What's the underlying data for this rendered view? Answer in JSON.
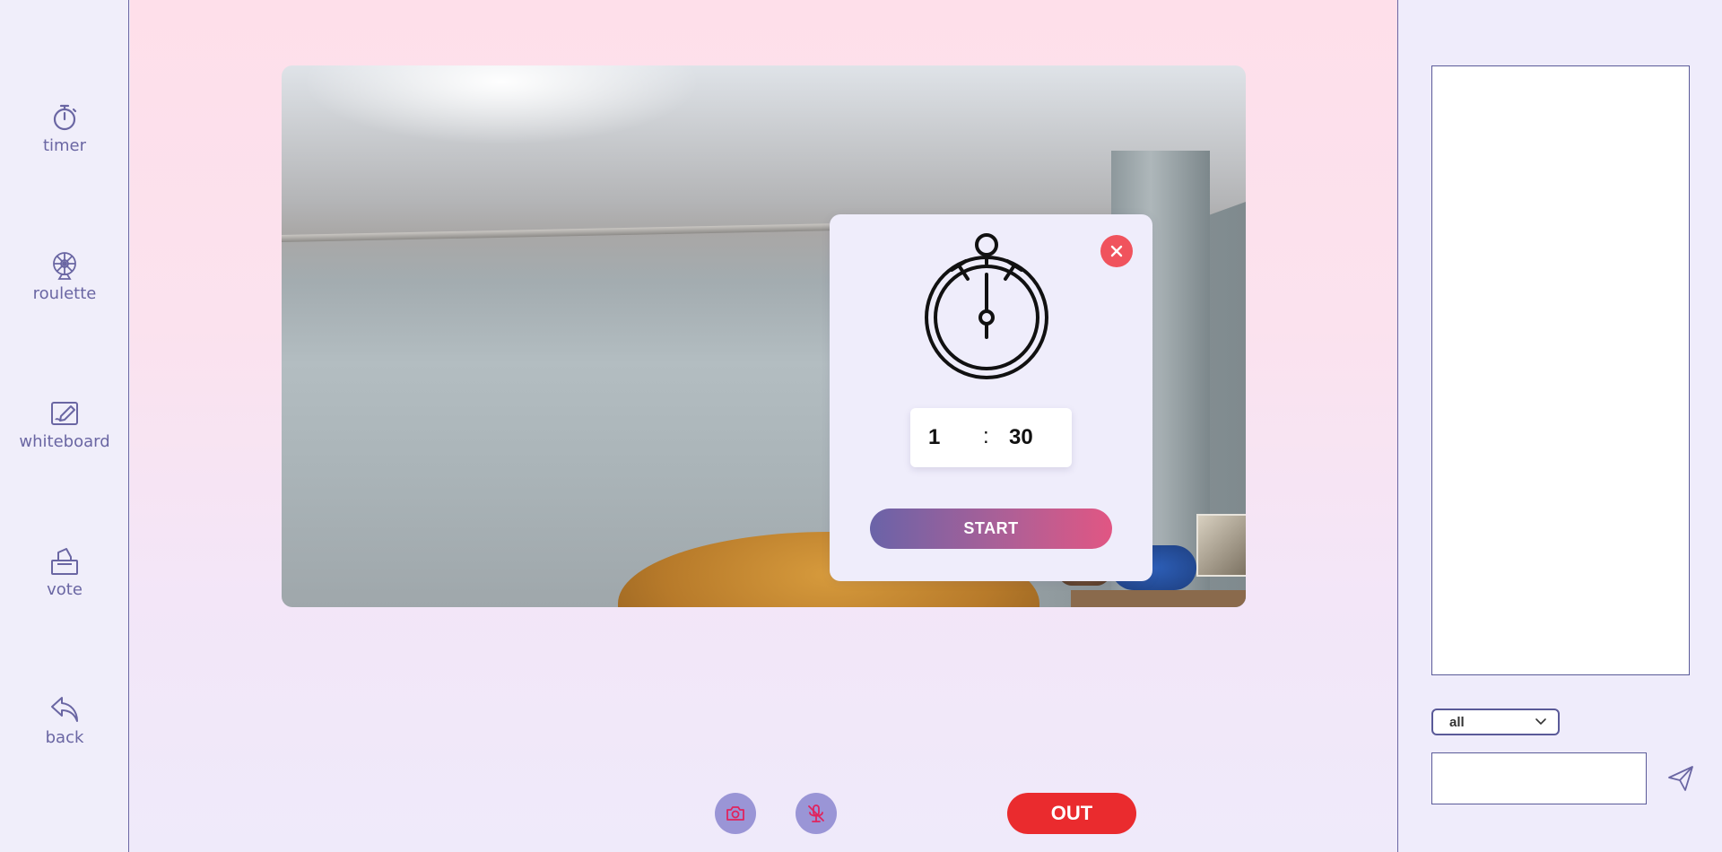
{
  "sidebar": {
    "items": [
      {
        "label": "timer",
        "icon": "stopwatch-icon"
      },
      {
        "label": "roulette",
        "icon": "roulette-wheel-icon"
      },
      {
        "label": "whiteboard",
        "icon": "whiteboard-pen-icon"
      },
      {
        "label": "vote",
        "icon": "ballot-box-icon"
      },
      {
        "label": "back",
        "icon": "back-arrow-icon"
      }
    ]
  },
  "timer_modal": {
    "minutes": "1",
    "separator": ":",
    "seconds": "30",
    "start_label": "START",
    "close_icon": "close-icon"
  },
  "controls": {
    "camera_icon": "camera-icon",
    "mic_icon": "microphone-off-icon",
    "out_label": "OUT"
  },
  "chat": {
    "target_selected": "all",
    "message_value": "",
    "send_icon": "send-icon"
  },
  "colors": {
    "accent": "#6a66a3",
    "danger": "#ea2b2e",
    "close": "#f0535d",
    "control_bg": "#9a95d6",
    "panel_bg": "#efecfb"
  }
}
